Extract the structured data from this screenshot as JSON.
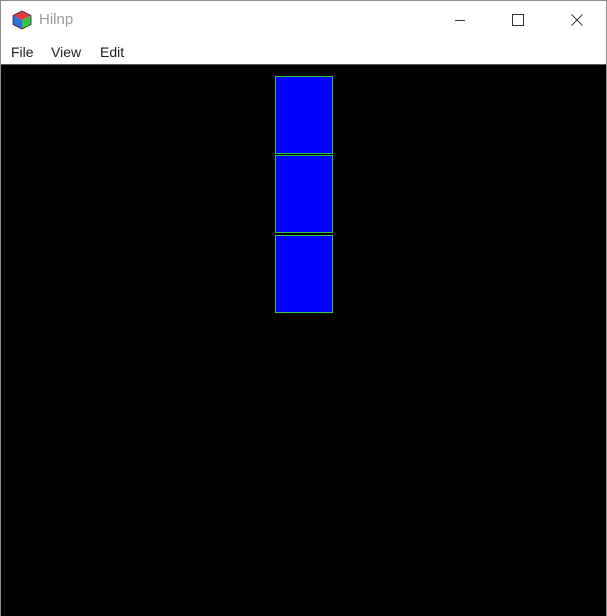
{
  "window": {
    "title": "Hilnp",
    "icon": "app-cube-icon"
  },
  "titlebar_buttons": [
    {
      "name": "minimize",
      "icon": "minimize-icon"
    },
    {
      "name": "maximize",
      "icon": "maximize-icon"
    },
    {
      "name": "close",
      "icon": "close-icon"
    }
  ],
  "menu": {
    "items": [
      {
        "label": "File"
      },
      {
        "label": "View"
      },
      {
        "label": "Edit"
      }
    ]
  },
  "canvas": {
    "background": "#000000",
    "blocks": [
      {
        "fill": "#0000ff",
        "outline": "#2ec84b"
      },
      {
        "fill": "#0000ff",
        "outline": "#2ec84b"
      },
      {
        "fill": "#0000ff",
        "outline": "#2ec84b"
      }
    ]
  }
}
